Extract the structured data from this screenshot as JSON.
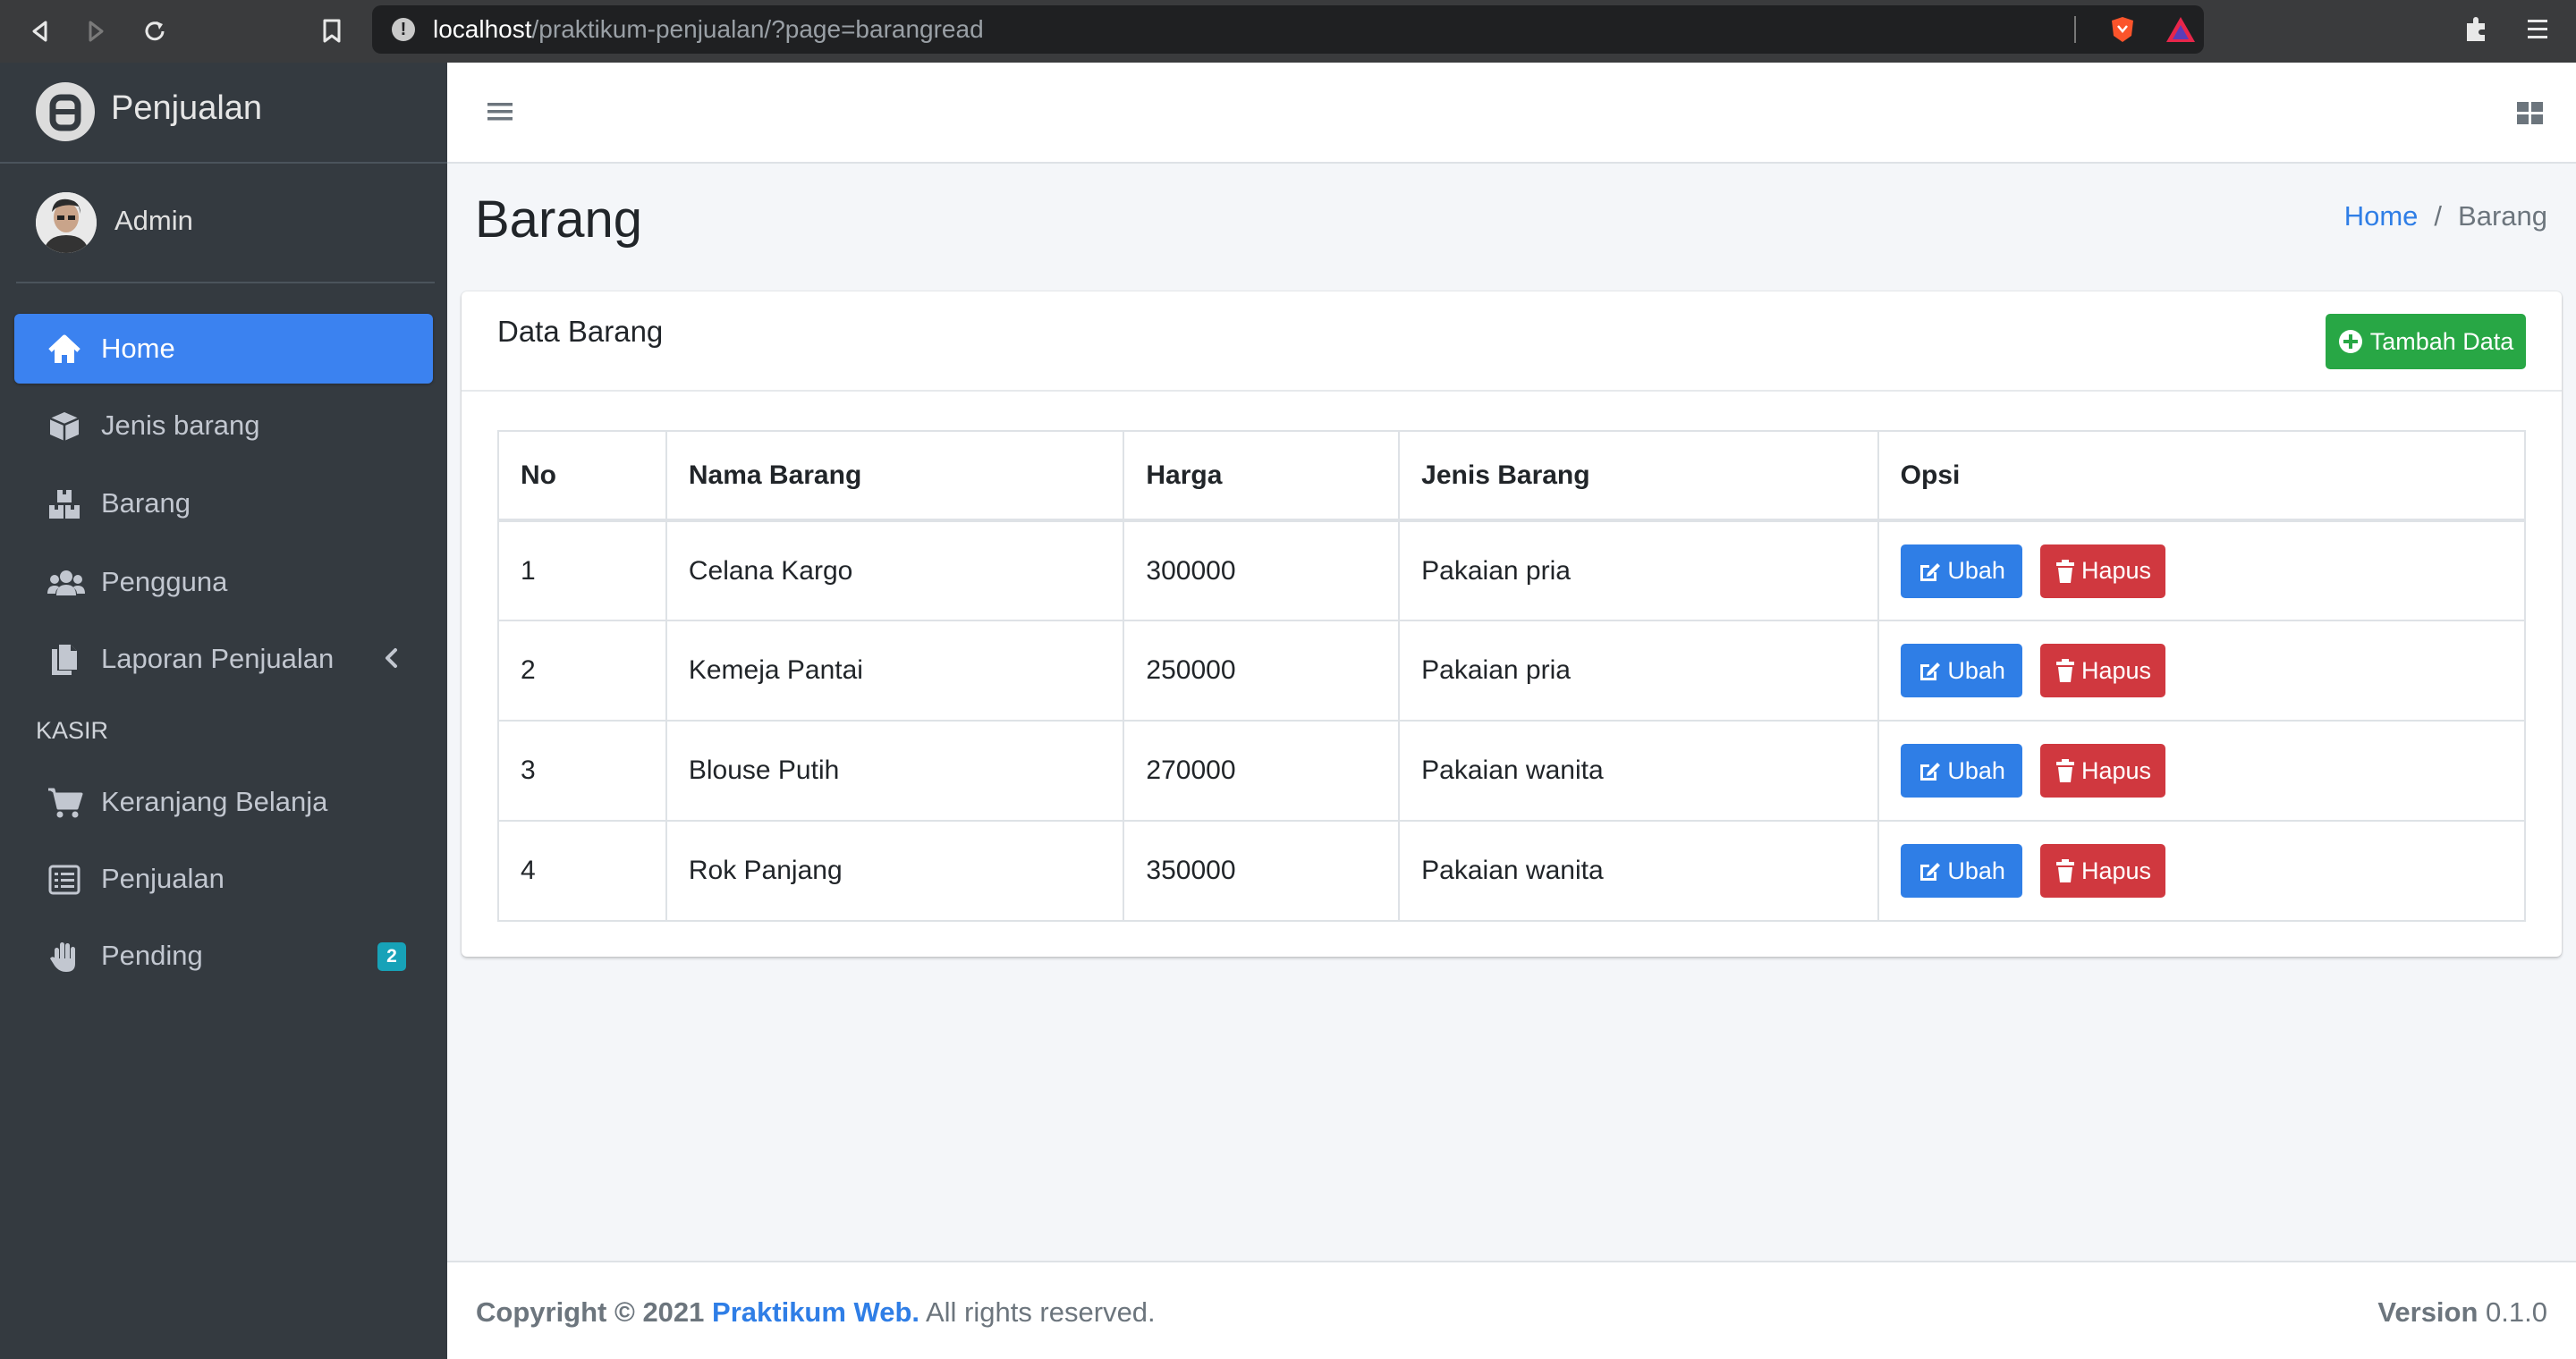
{
  "browser": {
    "url_host": "localhost",
    "url_path": "/praktikum-penjualan/?page=barangread"
  },
  "sidebar": {
    "brand": "Penjualan",
    "user": "Admin",
    "items": [
      {
        "label": "Home",
        "icon": "home-icon"
      },
      {
        "label": "Jenis barang",
        "icon": "box-icon"
      },
      {
        "label": "Barang",
        "icon": "boxes-icon"
      },
      {
        "label": "Pengguna",
        "icon": "users-icon"
      },
      {
        "label": "Laporan Penjualan",
        "icon": "file-copy-icon"
      }
    ],
    "section_header": "KASIR",
    "kasir_items": [
      {
        "label": "Keranjang Belanja",
        "icon": "cart-icon"
      },
      {
        "label": "Penjualan",
        "icon": "list-icon"
      },
      {
        "label": "Pending",
        "icon": "hand-icon",
        "badge": "2"
      }
    ]
  },
  "header": {
    "title": "Barang",
    "breadcrumb": {
      "home": "Home",
      "sep": "/",
      "current": "Barang"
    }
  },
  "card": {
    "title": "Data Barang",
    "add_button": "Tambah Data",
    "columns": [
      "No",
      "Nama Barang",
      "Harga",
      "Jenis Barang",
      "Opsi"
    ],
    "rows": [
      {
        "no": "1",
        "nama": "Celana Kargo",
        "harga": "300000",
        "jenis": "Pakaian pria"
      },
      {
        "no": "2",
        "nama": "Kemeja Pantai",
        "harga": "250000",
        "jenis": "Pakaian pria"
      },
      {
        "no": "3",
        "nama": "Blouse Putih",
        "harga": "270000",
        "jenis": "Pakaian wanita"
      },
      {
        "no": "4",
        "nama": "Rok Panjang",
        "harga": "350000",
        "jenis": "Pakaian wanita"
      }
    ],
    "edit_label": "Ubah",
    "delete_label": "Hapus"
  },
  "footer": {
    "copyright": "Copyright © 2021",
    "brand": "Praktikum Web.",
    "rights": "All rights reserved.",
    "version_label": "Version",
    "version": "0.1.0"
  },
  "colors": {
    "primary": "#3b82f0",
    "success": "#28a745",
    "danger": "#d0383f",
    "sidebar": "#343a40",
    "badge": "#17a2b8"
  }
}
